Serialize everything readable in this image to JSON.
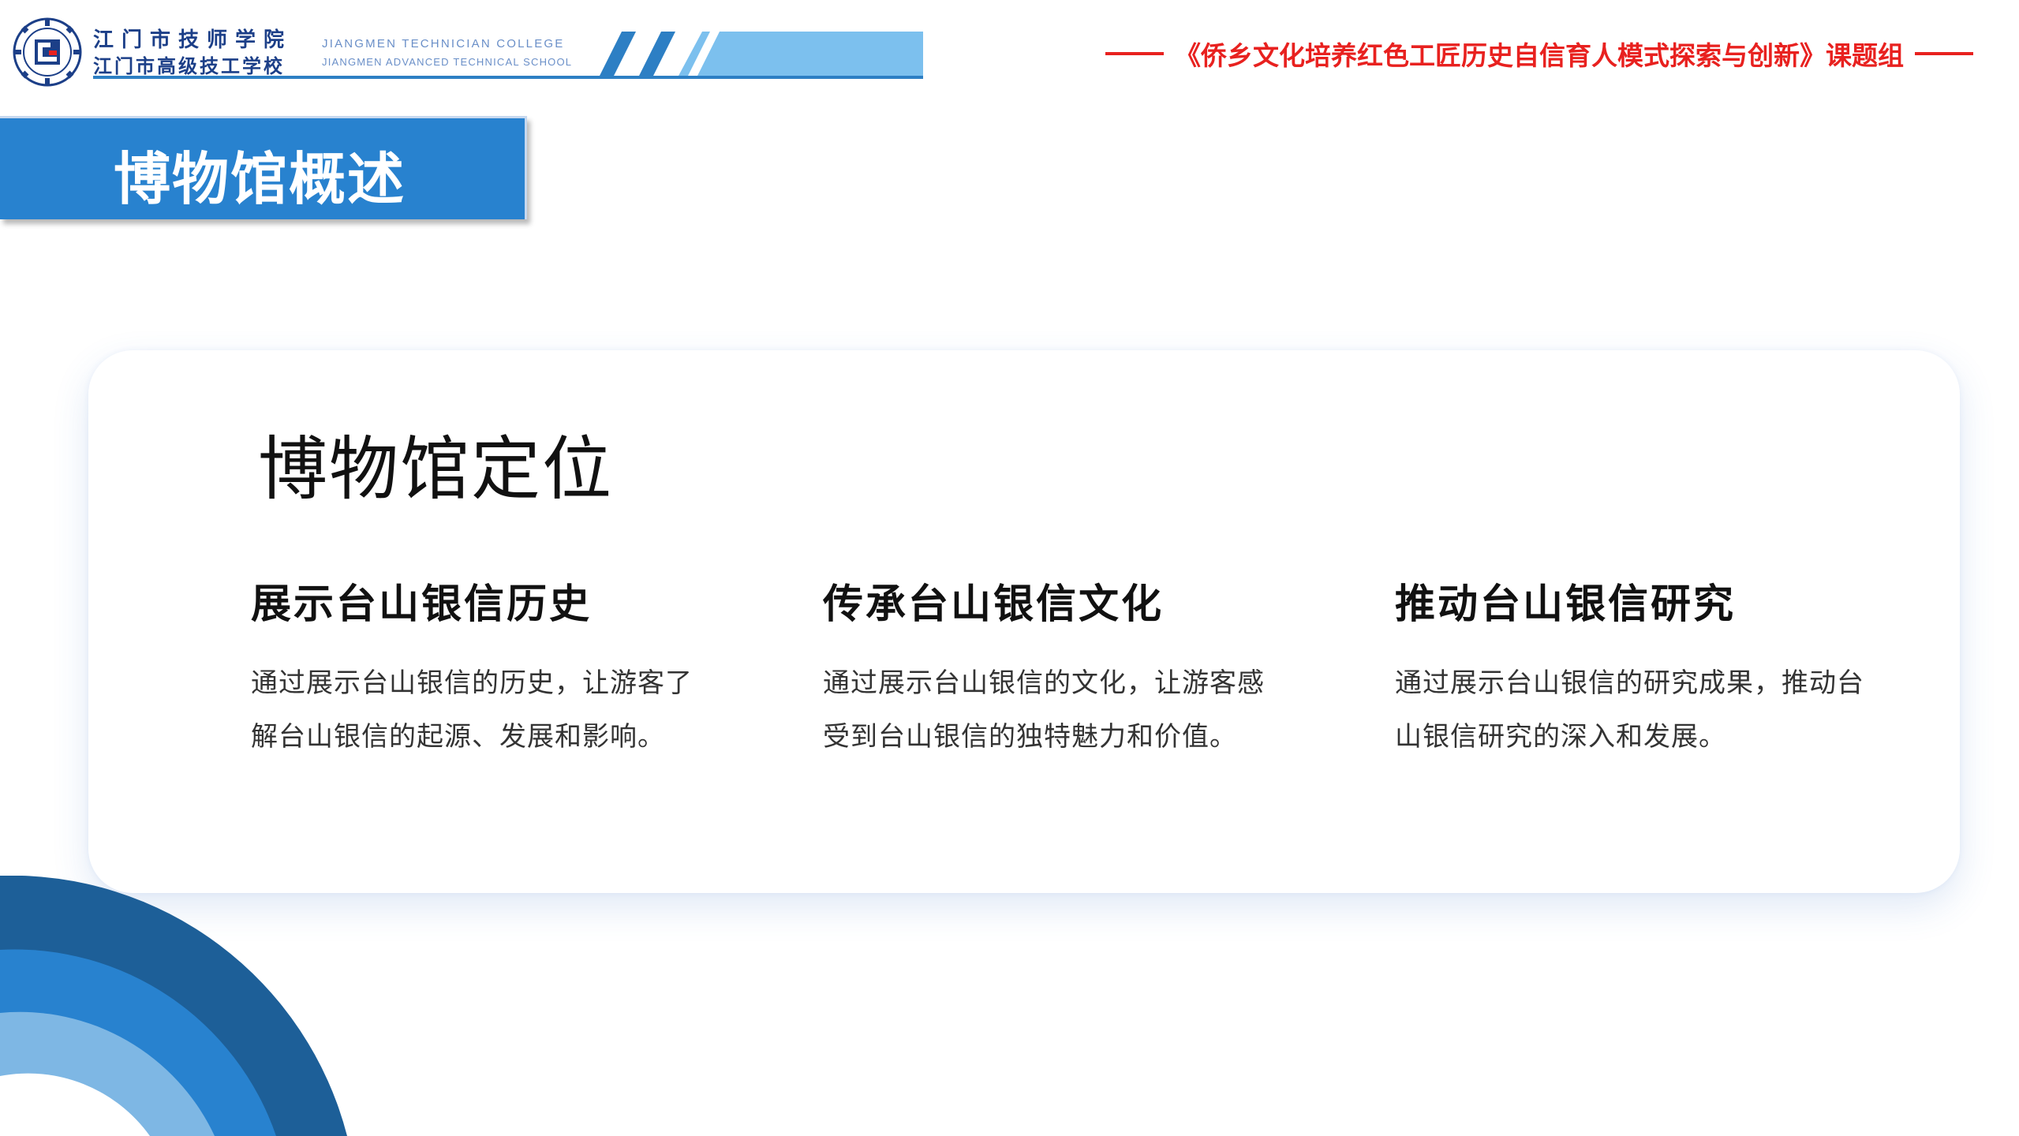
{
  "header": {
    "school_cn_line1": "江门市技师学院",
    "school_cn_line2": "江门市高级技工学校",
    "school_en_line1": "JIANGMEN TECHNICIAN COLLEGE",
    "school_en_line2": "JIANGMEN ADVANCED TECHNICAL SCHOOL",
    "project_title": "《侨乡文化培养红色工匠历史自信育人模式探索与创新》课题组",
    "accent_color": "#e8211f",
    "brand_blue": "#2882cf"
  },
  "section": {
    "title": "博物馆概述"
  },
  "card": {
    "title": "博物馆定位",
    "columns": [
      {
        "heading": "展示台山银信历史",
        "text": "通过展示台山银信的历史，让游客了解台山银信的起源、发展和影响。"
      },
      {
        "heading": "传承台山银信文化",
        "text": "通过展示台山银信的文化，让游客感受到台山银信的独特魅力和价值。"
      },
      {
        "heading": "推动台山银信研究",
        "text": "通过展示台山银信的研究成果，推动台山银信研究的深入和发展。"
      }
    ]
  }
}
